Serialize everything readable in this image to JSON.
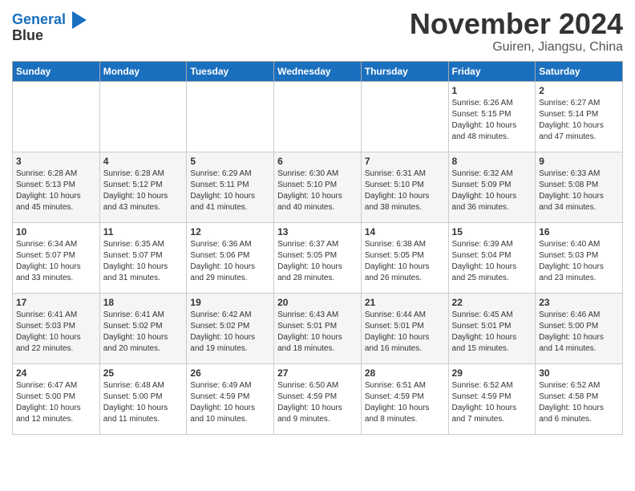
{
  "header": {
    "logo_line1": "General",
    "logo_line2": "Blue",
    "month": "November 2024",
    "location": "Guiren, Jiangsu, China"
  },
  "weekdays": [
    "Sunday",
    "Monday",
    "Tuesday",
    "Wednesday",
    "Thursday",
    "Friday",
    "Saturday"
  ],
  "weeks": [
    [
      {
        "day": "",
        "info": ""
      },
      {
        "day": "",
        "info": ""
      },
      {
        "day": "",
        "info": ""
      },
      {
        "day": "",
        "info": ""
      },
      {
        "day": "",
        "info": ""
      },
      {
        "day": "1",
        "info": "Sunrise: 6:26 AM\nSunset: 5:15 PM\nDaylight: 10 hours\nand 48 minutes."
      },
      {
        "day": "2",
        "info": "Sunrise: 6:27 AM\nSunset: 5:14 PM\nDaylight: 10 hours\nand 47 minutes."
      }
    ],
    [
      {
        "day": "3",
        "info": "Sunrise: 6:28 AM\nSunset: 5:13 PM\nDaylight: 10 hours\nand 45 minutes."
      },
      {
        "day": "4",
        "info": "Sunrise: 6:28 AM\nSunset: 5:12 PM\nDaylight: 10 hours\nand 43 minutes."
      },
      {
        "day": "5",
        "info": "Sunrise: 6:29 AM\nSunset: 5:11 PM\nDaylight: 10 hours\nand 41 minutes."
      },
      {
        "day": "6",
        "info": "Sunrise: 6:30 AM\nSunset: 5:10 PM\nDaylight: 10 hours\nand 40 minutes."
      },
      {
        "day": "7",
        "info": "Sunrise: 6:31 AM\nSunset: 5:10 PM\nDaylight: 10 hours\nand 38 minutes."
      },
      {
        "day": "8",
        "info": "Sunrise: 6:32 AM\nSunset: 5:09 PM\nDaylight: 10 hours\nand 36 minutes."
      },
      {
        "day": "9",
        "info": "Sunrise: 6:33 AM\nSunset: 5:08 PM\nDaylight: 10 hours\nand 34 minutes."
      }
    ],
    [
      {
        "day": "10",
        "info": "Sunrise: 6:34 AM\nSunset: 5:07 PM\nDaylight: 10 hours\nand 33 minutes."
      },
      {
        "day": "11",
        "info": "Sunrise: 6:35 AM\nSunset: 5:07 PM\nDaylight: 10 hours\nand 31 minutes."
      },
      {
        "day": "12",
        "info": "Sunrise: 6:36 AM\nSunset: 5:06 PM\nDaylight: 10 hours\nand 29 minutes."
      },
      {
        "day": "13",
        "info": "Sunrise: 6:37 AM\nSunset: 5:05 PM\nDaylight: 10 hours\nand 28 minutes."
      },
      {
        "day": "14",
        "info": "Sunrise: 6:38 AM\nSunset: 5:05 PM\nDaylight: 10 hours\nand 26 minutes."
      },
      {
        "day": "15",
        "info": "Sunrise: 6:39 AM\nSunset: 5:04 PM\nDaylight: 10 hours\nand 25 minutes."
      },
      {
        "day": "16",
        "info": "Sunrise: 6:40 AM\nSunset: 5:03 PM\nDaylight: 10 hours\nand 23 minutes."
      }
    ],
    [
      {
        "day": "17",
        "info": "Sunrise: 6:41 AM\nSunset: 5:03 PM\nDaylight: 10 hours\nand 22 minutes."
      },
      {
        "day": "18",
        "info": "Sunrise: 6:41 AM\nSunset: 5:02 PM\nDaylight: 10 hours\nand 20 minutes."
      },
      {
        "day": "19",
        "info": "Sunrise: 6:42 AM\nSunset: 5:02 PM\nDaylight: 10 hours\nand 19 minutes."
      },
      {
        "day": "20",
        "info": "Sunrise: 6:43 AM\nSunset: 5:01 PM\nDaylight: 10 hours\nand 18 minutes."
      },
      {
        "day": "21",
        "info": "Sunrise: 6:44 AM\nSunset: 5:01 PM\nDaylight: 10 hours\nand 16 minutes."
      },
      {
        "day": "22",
        "info": "Sunrise: 6:45 AM\nSunset: 5:01 PM\nDaylight: 10 hours\nand 15 minutes."
      },
      {
        "day": "23",
        "info": "Sunrise: 6:46 AM\nSunset: 5:00 PM\nDaylight: 10 hours\nand 14 minutes."
      }
    ],
    [
      {
        "day": "24",
        "info": "Sunrise: 6:47 AM\nSunset: 5:00 PM\nDaylight: 10 hours\nand 12 minutes."
      },
      {
        "day": "25",
        "info": "Sunrise: 6:48 AM\nSunset: 5:00 PM\nDaylight: 10 hours\nand 11 minutes."
      },
      {
        "day": "26",
        "info": "Sunrise: 6:49 AM\nSunset: 4:59 PM\nDaylight: 10 hours\nand 10 minutes."
      },
      {
        "day": "27",
        "info": "Sunrise: 6:50 AM\nSunset: 4:59 PM\nDaylight: 10 hours\nand 9 minutes."
      },
      {
        "day": "28",
        "info": "Sunrise: 6:51 AM\nSunset: 4:59 PM\nDaylight: 10 hours\nand 8 minutes."
      },
      {
        "day": "29",
        "info": "Sunrise: 6:52 AM\nSunset: 4:59 PM\nDaylight: 10 hours\nand 7 minutes."
      },
      {
        "day": "30",
        "info": "Sunrise: 6:52 AM\nSunset: 4:58 PM\nDaylight: 10 hours\nand 6 minutes."
      }
    ]
  ]
}
